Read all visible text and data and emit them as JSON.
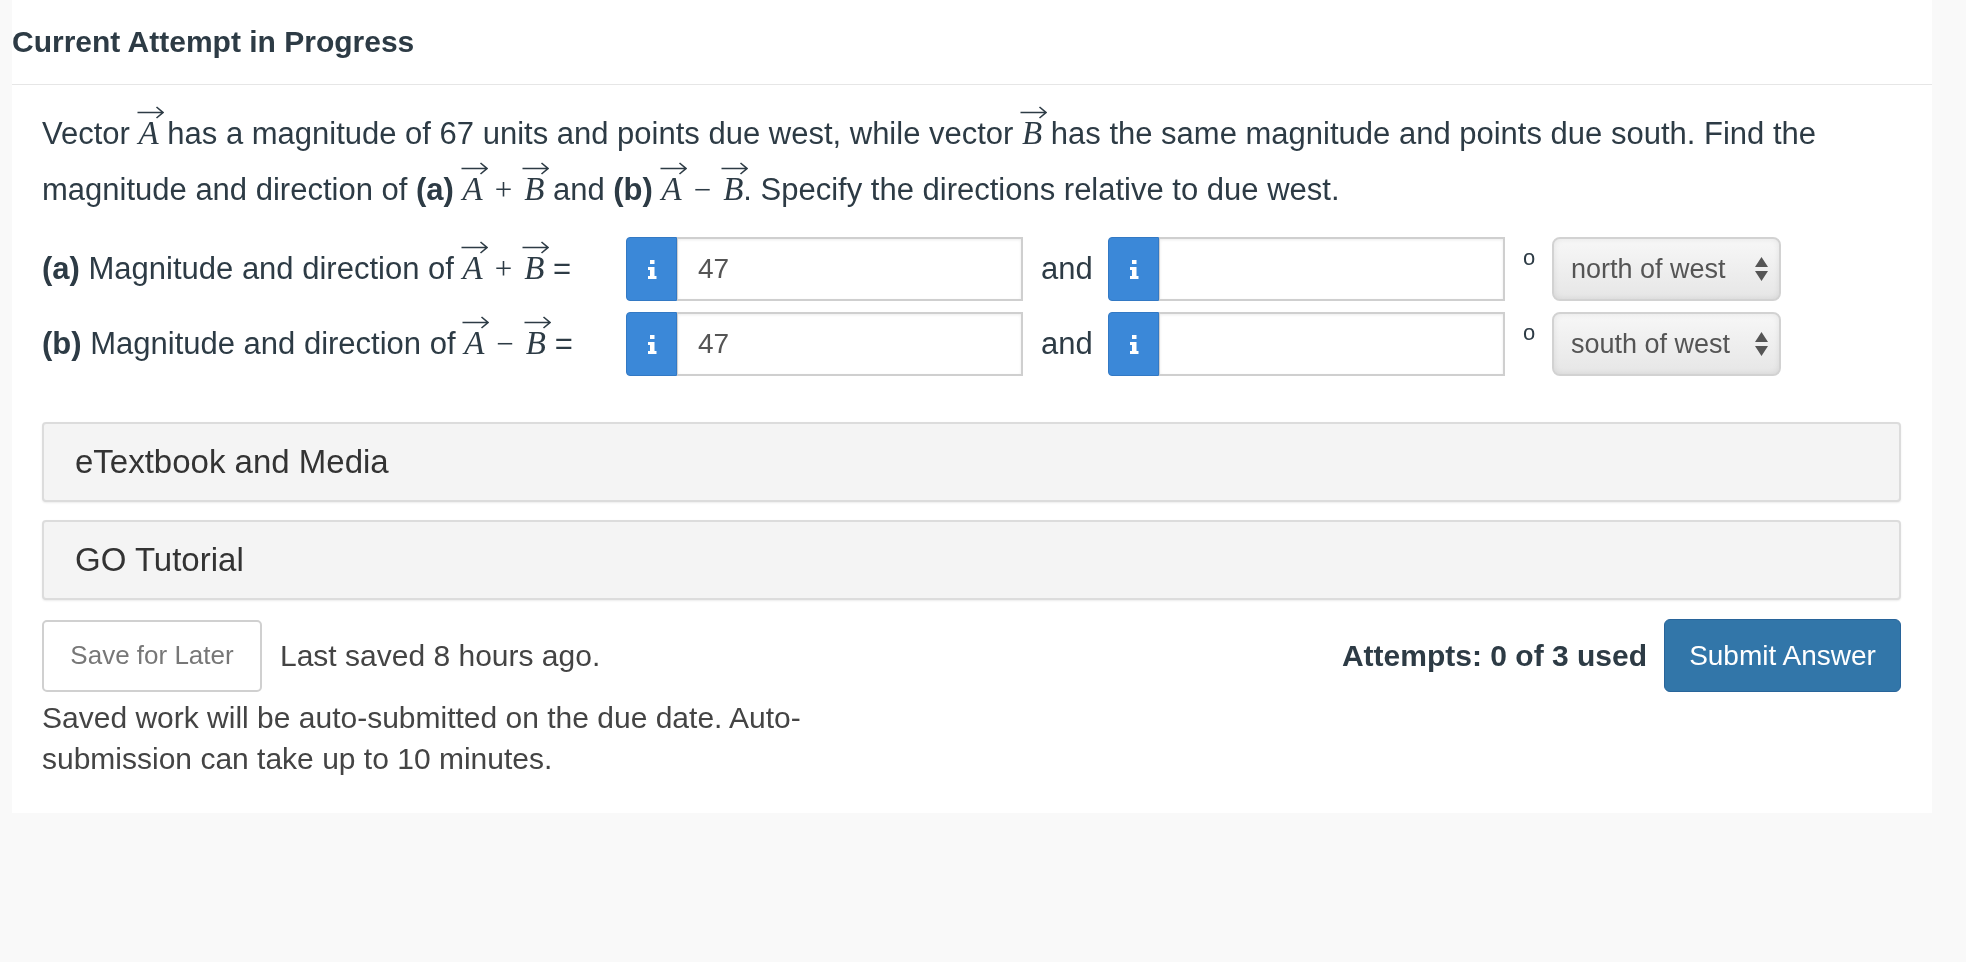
{
  "header": {
    "title": "Current Attempt in Progress"
  },
  "question": {
    "segments": [
      {
        "kind": "text",
        "text": "Vector "
      },
      {
        "kind": "vector",
        "symbol": "A"
      },
      {
        "kind": "text",
        "text": " has a magnitude of 67 units and points due west, while vector "
      },
      {
        "kind": "vector",
        "symbol": "B"
      },
      {
        "kind": "text",
        "text": " has the same magnitude and points due south. Find the magnitude and direction of **(a)** "
      },
      {
        "kind": "vector",
        "symbol": "A"
      },
      {
        "kind": "operator",
        "symbol": "+"
      },
      {
        "kind": "vector",
        "symbol": "B"
      },
      {
        "kind": "text",
        "text": " and **(b)** "
      },
      {
        "kind": "vector",
        "symbol": "A"
      },
      {
        "kind": "operator",
        "symbol": "−"
      },
      {
        "kind": "vector",
        "symbol": "B"
      },
      {
        "kind": "text",
        "text": ". Specify the directions relative to due west."
      }
    ]
  },
  "parts": [
    {
      "label": [
        {
          "kind": "text",
          "text": "**(a)** Magnitude and direction of "
        },
        {
          "kind": "vector",
          "symbol": "A"
        },
        {
          "kind": "operator",
          "symbol": "+"
        },
        {
          "kind": "vector",
          "symbol": "B"
        },
        {
          "kind": "text",
          "text": " ="
        }
      ],
      "magnitude_value": "47",
      "connector": "and",
      "unit": "o",
      "direction": "north of west"
    },
    {
      "label": [
        {
          "kind": "text",
          "text": "**(b)** Magnitude and direction of "
        },
        {
          "kind": "vector",
          "symbol": "A"
        },
        {
          "kind": "operator",
          "symbol": "−"
        },
        {
          "kind": "vector",
          "symbol": "B"
        },
        {
          "kind": "text",
          "text": " ="
        }
      ],
      "magnitude_value": "47",
      "connector": "and",
      "unit": "o",
      "direction": "south of west"
    }
  ],
  "resources": [
    {
      "title": "eTextbook and Media"
    },
    {
      "title": "GO Tutorial"
    }
  ],
  "footer": {
    "save_button": "Save for Later",
    "last_saved": "Last saved 8 hours ago.",
    "attempts": "Attempts: 0 of 3 used",
    "submit_button": "Submit Answer",
    "note": "Saved work will be auto-submitted on the due date. Auto-submission can take up to 10 minutes."
  }
}
